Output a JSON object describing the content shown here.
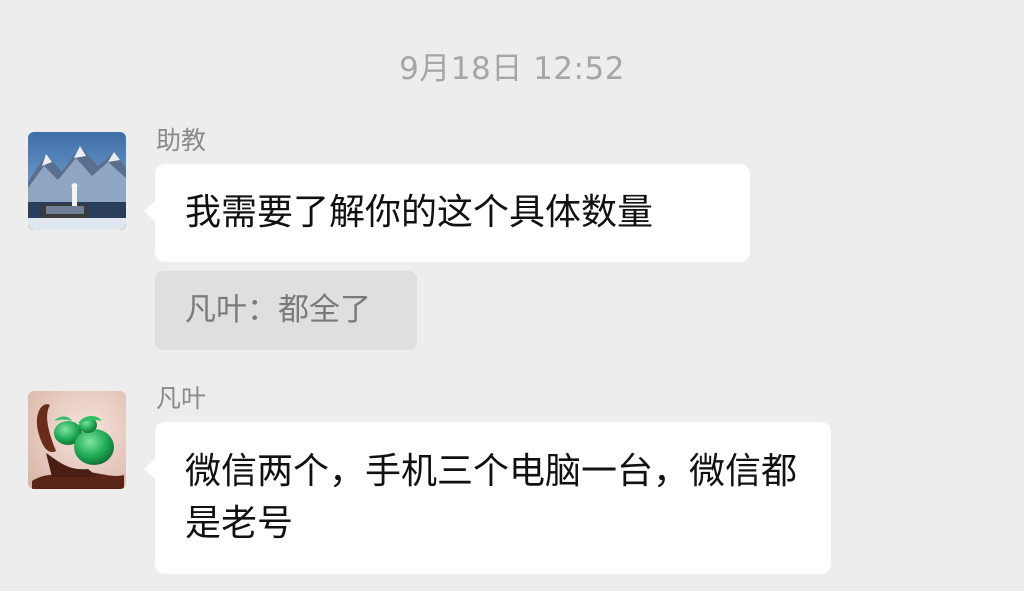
{
  "chat": {
    "timestamp": "9月18日 12:52",
    "messages": [
      {
        "sender": "助教",
        "text": "我需要了解你的这个具体数量",
        "quote": "凡叶：都全了"
      },
      {
        "sender": "凡叶",
        "text": "微信两个，手机三个电脑一台，微信都是老号"
      }
    ]
  }
}
